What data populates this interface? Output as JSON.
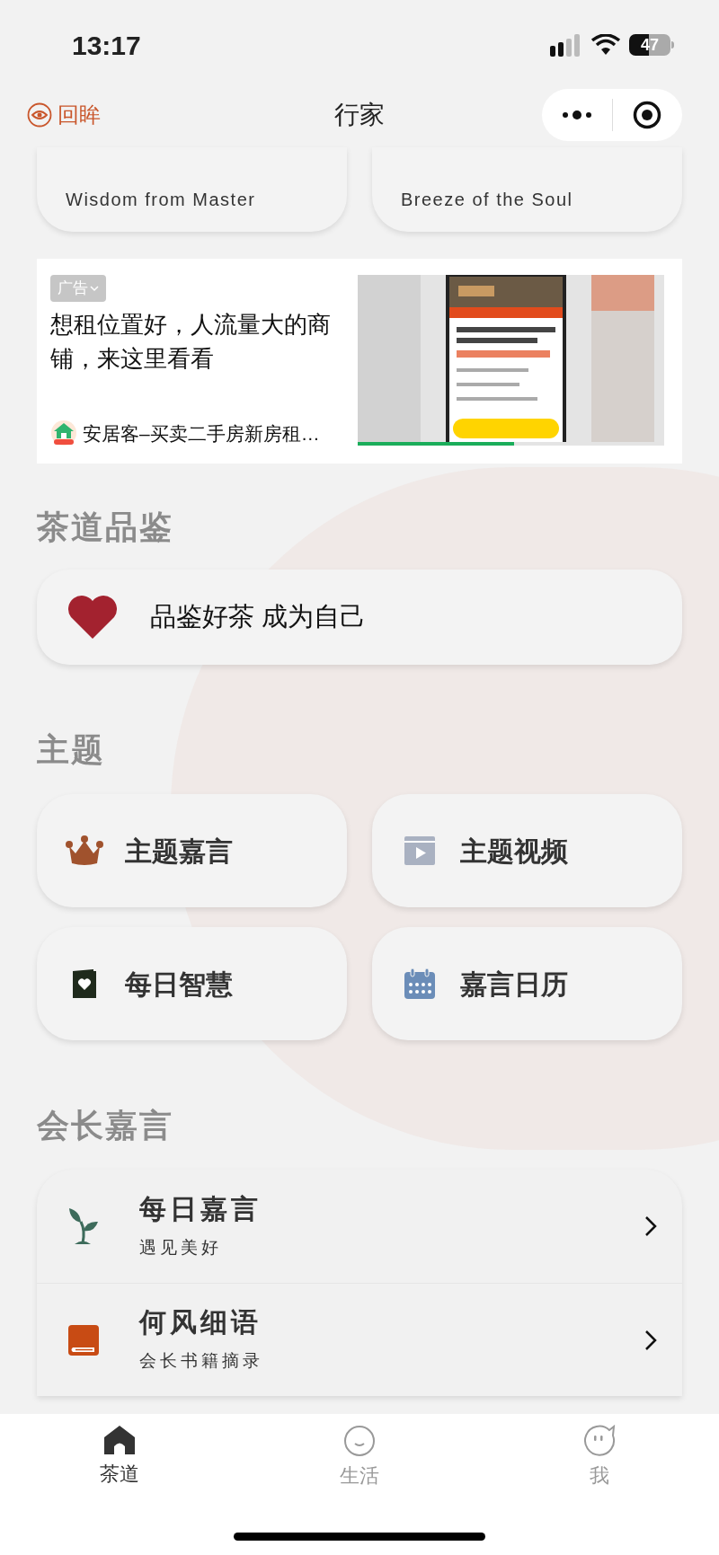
{
  "status_bar": {
    "time": "13:17",
    "battery": "47"
  },
  "nav": {
    "back_label": "回眸",
    "title": "行家"
  },
  "top_cards": [
    {
      "subtitle": "Wisdom from Master"
    },
    {
      "subtitle": "Breeze of the Soul"
    }
  ],
  "ad": {
    "label": "广告",
    "headline": "想租位置好，人流量大的商铺，来这里看看",
    "source": "安居客–买卖二手房新房租…",
    "video": {
      "level": 0.51
    }
  },
  "tea_section": {
    "heading": "茶道品鉴",
    "card": {
      "text": "品鉴好茶 成为自己"
    }
  },
  "theme_section": {
    "heading": "主题",
    "items": [
      {
        "label": "主题嘉言",
        "kind": "crown"
      },
      {
        "label": "主题视频",
        "kind": "video"
      },
      {
        "label": "每日智慧",
        "kind": "card"
      },
      {
        "label": "嘉言日历",
        "kind": "calendar"
      }
    ]
  },
  "president_section": {
    "heading": "会长嘉言",
    "rows": [
      {
        "title": "每日嘉言",
        "subtitle": "遇见美好",
        "kind": "sprout"
      },
      {
        "title": "何风细语",
        "subtitle": "会长书籍摘录",
        "kind": "book"
      }
    ]
  },
  "tab_bar": [
    {
      "label": "茶道",
      "selected": true,
      "kind": "home"
    },
    {
      "label": "生活",
      "selected": false,
      "kind": "smile"
    },
    {
      "label": "我",
      "selected": false,
      "kind": "face"
    }
  ]
}
